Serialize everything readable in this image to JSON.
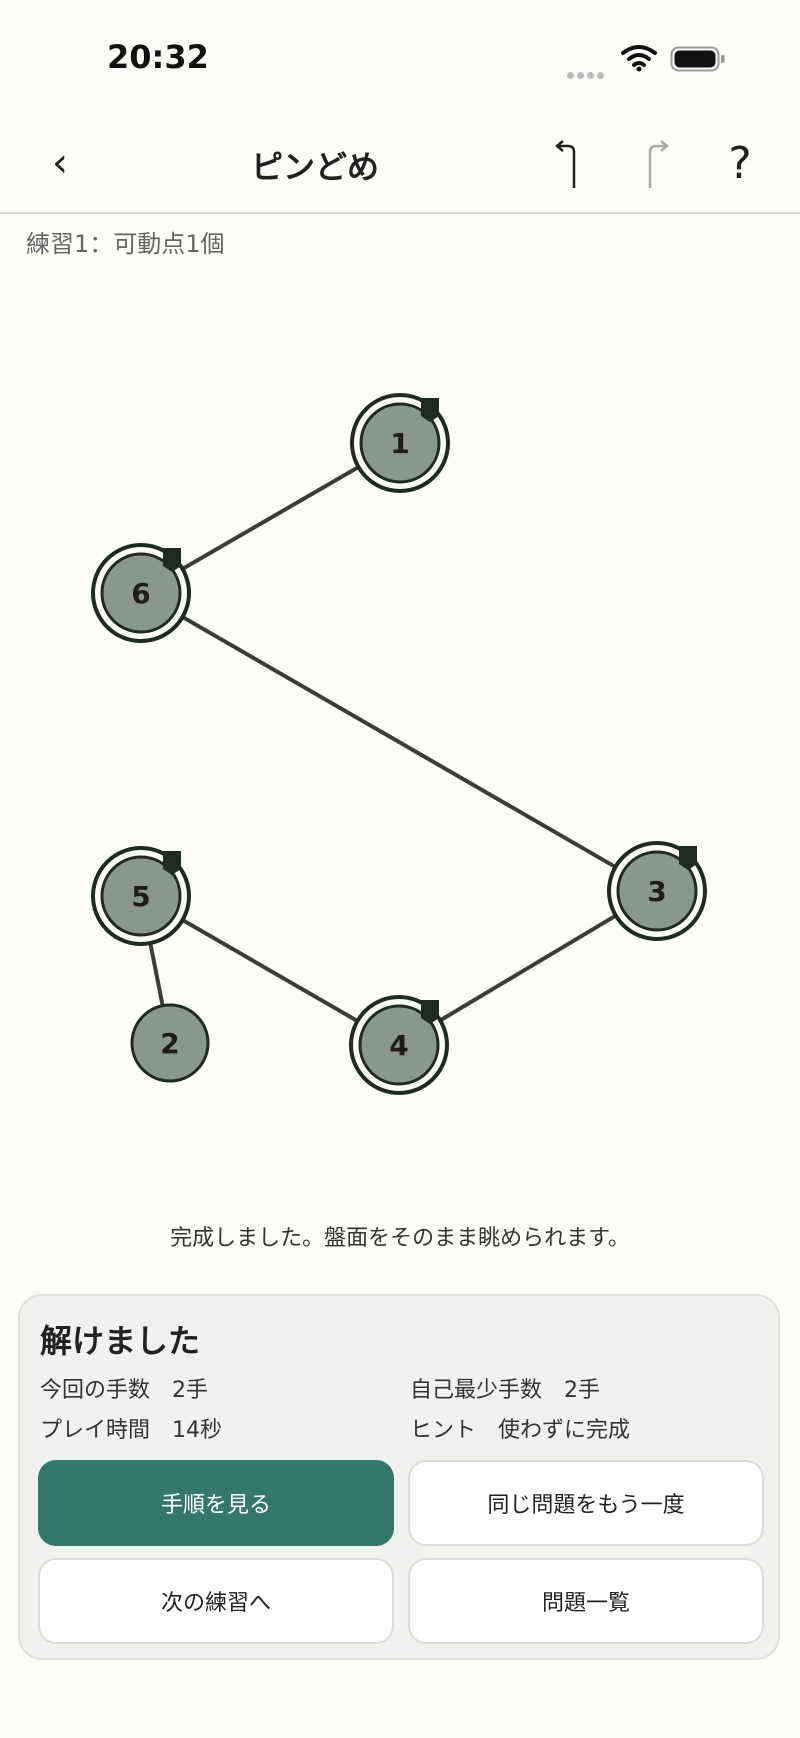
{
  "status_bar": {
    "time": "20:32"
  },
  "nav": {
    "back_label": "‹",
    "title": "ピンどめ",
    "help_label": "?"
  },
  "puzzle": {
    "label": "練習1：可動点1個",
    "nodes": [
      {
        "id": "1",
        "pinned": true
      },
      {
        "id": "6",
        "pinned": true
      },
      {
        "id": "5",
        "pinned": true
      },
      {
        "id": "3",
        "pinned": true
      },
      {
        "id": "2",
        "pinned": false
      },
      {
        "id": "4",
        "pinned": true
      }
    ],
    "edges": [
      [
        "1",
        "6"
      ],
      [
        "6",
        "3"
      ],
      [
        "5",
        "2"
      ],
      [
        "5",
        "4"
      ],
      [
        "4",
        "3"
      ]
    ]
  },
  "message": "完成しました。盤面をそのまま眺められます。",
  "result": {
    "title": "解けました",
    "moves": "今回の手数　2手",
    "best_moves": "自己最少手数　2手",
    "play_time": "プレイ時間　14秒",
    "hint": "ヒント　使わずに完成",
    "show_steps_label": "手順を見る",
    "retry_label": "同じ問題をもう一度",
    "next_label": "次の練習へ",
    "list_label": "問題一覧"
  },
  "colors": {
    "accent": "#33786b",
    "node_fill": "#8a978d",
    "node_stroke": "#1f2a22",
    "edge": "#3a3d38",
    "background": "#fcfcf8"
  }
}
